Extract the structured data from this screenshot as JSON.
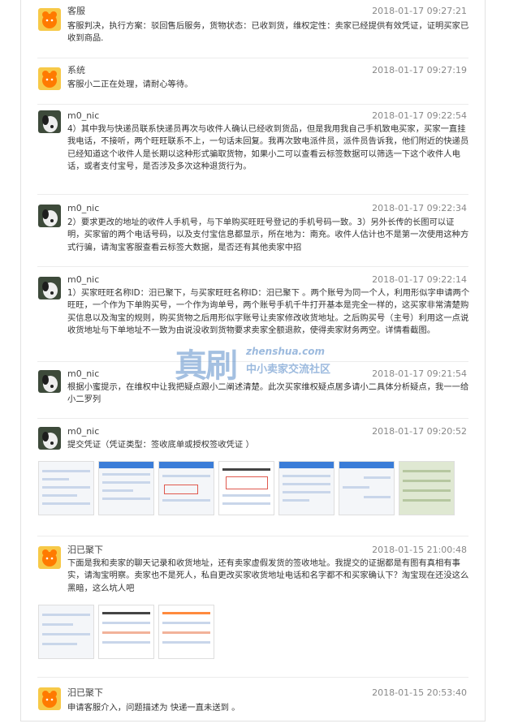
{
  "messages": [
    {
      "sender": "客服",
      "avatar": "service-avatar",
      "time": "2018-01-17 09:27:21",
      "text": "客服判决，执行方案：驳回售后服务，货物状态：已收到货，维权定性：卖家已经提供有效凭证，证明买家已收到商品."
    },
    {
      "sender": "系统",
      "avatar": "service-avatar",
      "time": "2018-01-17 09:27:19",
      "text": "客服小二正在处理，请耐心等待。"
    },
    {
      "sender": "m0_nic",
      "avatar": "dog-avatar",
      "time": "2018-01-17 09:22:54",
      "text": "4）其中我与快递员联系快递员再次与收件人确认已经收到货品，但是我用我自己手机致电买家，买家一直挂我电话，不接听，两个旺旺联系不上，一句话未回复。我再次致电派件员，派件员告诉我，他们附近的快递员已经知道这个收件人是长期以这种形式骗取货物，如果小二可以查看云标签数据可以筛选一下这个收件人电话，或者支付宝号，是否涉及多次这种退货行为。"
    },
    {
      "sender": "m0_nic",
      "avatar": "dog-avatar",
      "time": "2018-01-17 09:22:34",
      "text": "2）要求更改的地址的收件人手机号，与下单购买旺旺号登记的手机号码一致。3）另外长传的长图可以证明，买家留的两个电话号码，以及支付宝信息都显示，所在地为：南充。收件人估计也不是第一次使用这种方式行骗，请淘宝客服查看云标签大数据，是否还有其他卖家中招"
    },
    {
      "sender": "m0_nic",
      "avatar": "dog-avatar",
      "time": "2018-01-17 09:22:14",
      "text": "1）买家旺旺名称ID：汨已聚下，与买家旺旺名称ID：汨已聚下 。两个账号为同一个人，利用形似字申请两个旺旺，一个作为下单购买号，一个作为询单号，两个账号手机千牛打开基本是完全一样的，这买家非常清楚购买信息以及淘宝的规则，购买货物之后用形似字账号让卖家修改收货地址。之后购买号（主号）利用这一点说收货地址与下单地址不一致为由说没收到货物要求卖家全额退款，使得卖家财务两空。详情看截图。"
    },
    {
      "sender": "m0_nic",
      "avatar": "dog-avatar",
      "time": "2018-01-17 09:21:54",
      "text": "根据小蜜提示，在维权中让我把疑点跟小二阐述清楚。此次买家维权疑点居多请小二具体分析疑点，我一一给小二罗列"
    },
    {
      "sender": "m0_nic",
      "avatar": "dog-avatar",
      "time": "2018-01-17 09:20:52",
      "text": "提交凭证（凭证类型：签收底单或授权签收凭证 ）"
    },
    {
      "sender": "汨已聚下",
      "avatar": "service-avatar",
      "time": "2018-01-15 21:00:48",
      "text": "下面是我和卖家的聊天记录和收货地址，还有卖家虚假发货的签收地址。我提交的证据都是有图有真相有事实，请淘宝明察。卖家也不是死人，私自更改买家收货地址电话和名字都不和买家确认下？淘宝现在还没这么黑暗，这么坑人吧"
    },
    {
      "sender": "汨已聚下",
      "avatar": "service-avatar",
      "time": "2018-01-15 20:53:40",
      "text": "申请客服介入，问题描述为 快递一直未送到 。"
    }
  ],
  "watermark": {
    "brand": "真刷",
    "domain": "zhenshua.com",
    "tagline": "中小卖家交流社区"
  }
}
